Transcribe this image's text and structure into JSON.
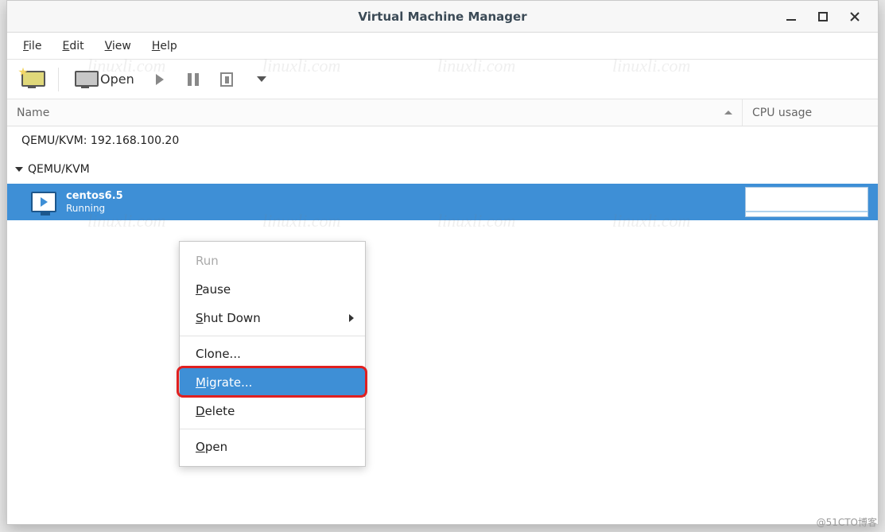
{
  "window": {
    "title": "Virtual Machine Manager"
  },
  "menubar": {
    "file": "File",
    "edit": "Edit",
    "view": "View",
    "help": "Help"
  },
  "toolbar": {
    "open_label": "Open"
  },
  "columns": {
    "name": "Name",
    "cpu": "CPU usage"
  },
  "hosts": {
    "remote": "QEMU/KVM: 192.168.100.20",
    "local": "QEMU/KVM"
  },
  "vm": {
    "name": "centos6.5",
    "status": "Running"
  },
  "context_menu": {
    "run": "Run",
    "pause_u": "P",
    "pause_rest": "ause",
    "shutdown_u": "S",
    "shutdown_rest": "hut Down",
    "clone": "Clone...",
    "migrate_u": "M",
    "migrate_rest": "igrate...",
    "delete_u": "D",
    "delete_rest": "elete",
    "open_u": "O",
    "open_rest": "pen"
  },
  "watermark": "linuxli.com",
  "footer": "@51CTO博客"
}
